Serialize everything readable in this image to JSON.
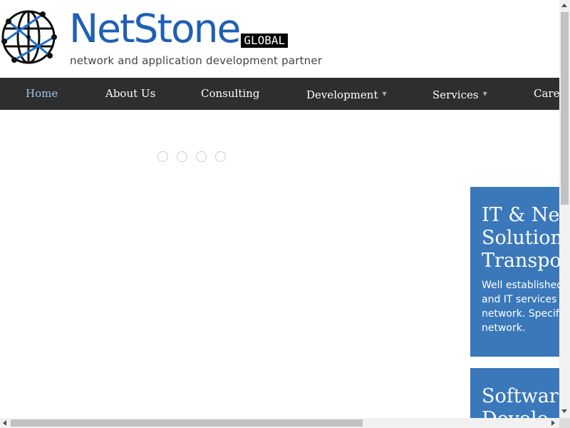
{
  "header": {
    "brand_name": "NetStone",
    "brand_badge": "GLOBAL",
    "tagline": "network and application development partner",
    "logo_icon": "globe-network-icon"
  },
  "nav": {
    "items": [
      {
        "label": "Home",
        "active": true
      },
      {
        "label": "About Us"
      },
      {
        "label": "Consulting"
      },
      {
        "label": "Development",
        "has_dropdown": true
      },
      {
        "label": "Services",
        "has_dropdown": true
      },
      {
        "label": "Caree"
      }
    ],
    "caret": "▼"
  },
  "slider": {
    "dot_count": 4
  },
  "cards": [
    {
      "title": "IT & Net\nSolution\nTranspor",
      "description": "Well established\nand IT services i\nnetwork. Specifi\nnetwork."
    },
    {
      "title": "Software\nDevelo"
    }
  ],
  "colors": {
    "brand_blue": "#1f5fb4",
    "nav_bg": "#2e2e2e",
    "nav_active": "#9cc3e6",
    "card_blue": "#3a78ba"
  }
}
